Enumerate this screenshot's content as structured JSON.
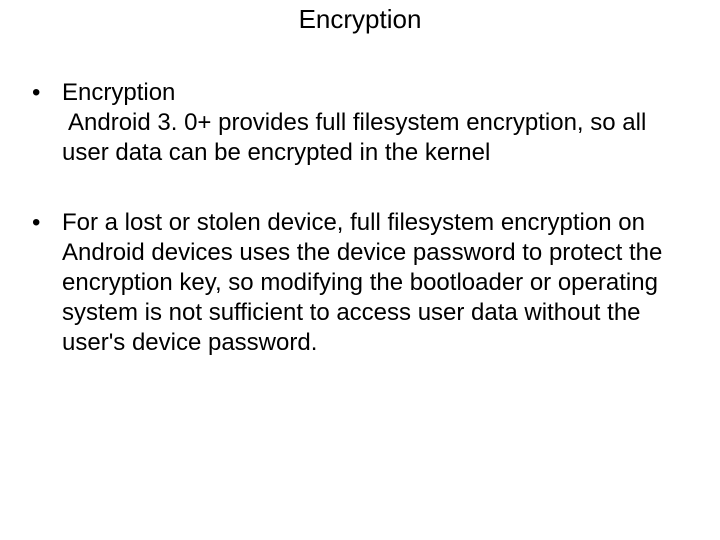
{
  "title": "Encryption",
  "bullets": [
    {
      "head": "Encryption",
      "sub": " Android 3. 0+ provides full filesystem encryption, so all user data can be encrypted in the kernel"
    },
    {
      "head": "For a lost or stolen device, full filesystem encryption on Android devices uses the device password to protect the encryption key, so modifying the bootloader or operating system is not sufficient to access user data without the user's device password."
    }
  ]
}
